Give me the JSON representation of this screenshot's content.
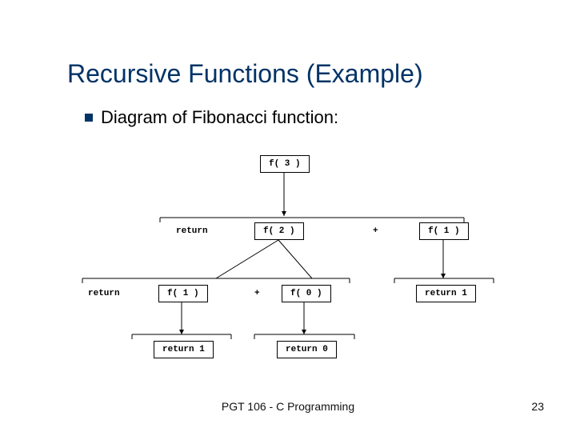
{
  "slide": {
    "title": "Recursive Functions (Example)",
    "subtitle": "Diagram of Fibonacci function:"
  },
  "nodes": {
    "f3": "f( 3 )",
    "f2": "f( 2 )",
    "f1a": "f( 1 )",
    "f1b": "f( 1 )",
    "f0": "f( 0 )",
    "ret1a": "return 1",
    "ret0": "return 0",
    "ret1b": "return 1"
  },
  "labels": {
    "return_top": "return",
    "plus_top": "+",
    "return_mid": "return",
    "plus_mid": "+"
  },
  "footer": {
    "text": "PGT 106 - C Programming",
    "page": "23"
  }
}
